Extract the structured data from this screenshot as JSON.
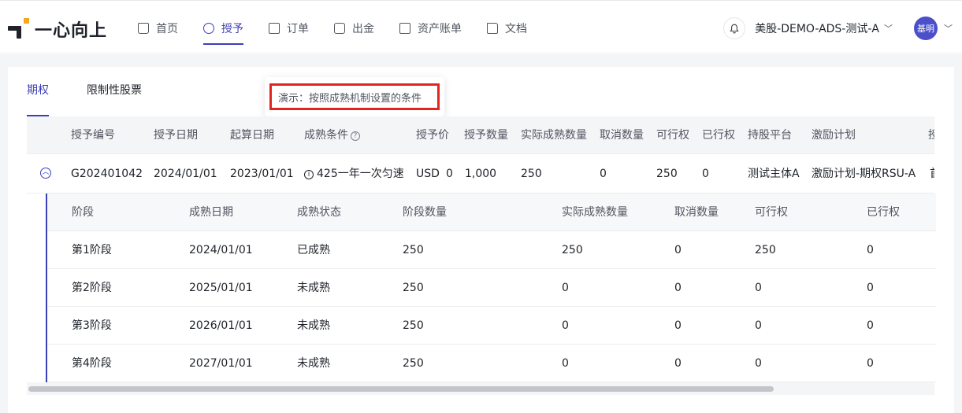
{
  "brand": {
    "name": "一心向上",
    "accent": "#3d3fb8",
    "mark_color": "#f5a623"
  },
  "nav": {
    "items": [
      {
        "label": "首页",
        "icon": "home-icon"
      },
      {
        "label": "授予",
        "icon": "grant-icon",
        "active": true
      },
      {
        "label": "订单",
        "icon": "order-icon"
      },
      {
        "label": "出金",
        "icon": "withdraw-icon"
      },
      {
        "label": "资产账单",
        "icon": "statement-icon"
      },
      {
        "label": "文档",
        "icon": "folder-icon"
      }
    ]
  },
  "header": {
    "account": "美股-DEMO-ADS-测试-A",
    "avatar_text": "基明"
  },
  "tabs": [
    {
      "label": "期权",
      "active": true
    },
    {
      "label": "限制性股票"
    }
  ],
  "tooltip": {
    "text": "演示：按照成熟机制设置的条件"
  },
  "table": {
    "columns": [
      "授予编号",
      "授予日期",
      "起算日期",
      "成熟条件",
      "授予价",
      "授予数量",
      "实际成熟数量",
      "取消数量",
      "可行权",
      "已行权",
      "持股平台",
      "激励计划",
      "授"
    ],
    "row": {
      "grant_no": "G202401042",
      "grant_date": "2024/01/01",
      "start_date": "2023/01/01",
      "vesting": "425一年一次匀速",
      "price_currency": "USD",
      "price": "0",
      "quantity": "1,000",
      "vested": "250",
      "cancelled": "0",
      "exercisable": "250",
      "exercised": "0",
      "platform": "测试主体A",
      "plan": "激励计划-期权RSU-A",
      "truncated": "首"
    }
  },
  "schedule": {
    "columns": [
      "阶段",
      "成熟日期",
      "成熟状态",
      "阶段数量",
      "实际成熟数量",
      "取消数量",
      "可行权",
      "已行权"
    ],
    "rows": [
      [
        "第1阶段",
        "2024/01/01",
        "已成熟",
        "250",
        "250",
        "0",
        "250",
        "0"
      ],
      [
        "第2阶段",
        "2025/01/01",
        "未成熟",
        "250",
        "0",
        "0",
        "0",
        "0"
      ],
      [
        "第3阶段",
        "2026/01/01",
        "未成熟",
        "250",
        "0",
        "0",
        "0",
        "0"
      ],
      [
        "第4阶段",
        "2027/01/01",
        "未成熟",
        "250",
        "0",
        "0",
        "0",
        "0"
      ]
    ]
  }
}
